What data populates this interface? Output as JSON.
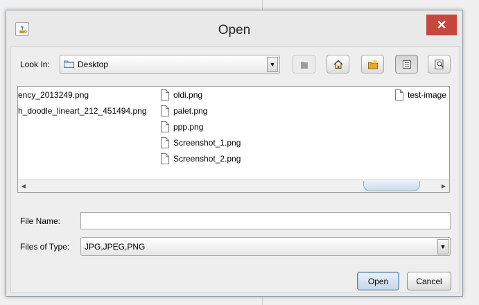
{
  "dialog": {
    "title": "Open"
  },
  "look_in": {
    "label": "Look In:",
    "value": "Desktop"
  },
  "toolbar": {
    "icons": [
      "up-folder-icon",
      "home-icon",
      "new-folder-icon",
      "list-view-icon",
      "details-view-icon"
    ]
  },
  "files": [
    {
      "name": "ency_2013249.png"
    },
    {
      "name": "h_doodle_lineart_212_451494.png"
    },
    {
      "name": "oldi.png"
    },
    {
      "name": "palet.png"
    },
    {
      "name": "ppp.png"
    },
    {
      "name": "Screenshot_1.png"
    },
    {
      "name": "Screenshot_2.png"
    },
    {
      "name": "test-image"
    }
  ],
  "file_name": {
    "label": "File Name:",
    "value": ""
  },
  "files_of_type": {
    "label": "Files of Type:",
    "value": "JPG,JPEG,PNG"
  },
  "buttons": {
    "open": "Open",
    "cancel": "Cancel"
  },
  "close_glyph": "✕"
}
